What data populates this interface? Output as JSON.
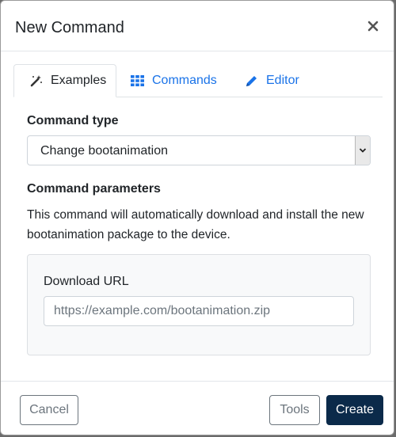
{
  "modal": {
    "title": "New Command",
    "close_icon": "close-icon"
  },
  "tabs": [
    {
      "label": "Examples",
      "icon": "magic-wand-icon",
      "active": true
    },
    {
      "label": "Commands",
      "icon": "grid-icon",
      "active": false
    },
    {
      "label": "Editor",
      "icon": "pencil-icon",
      "active": false
    }
  ],
  "command_type": {
    "label": "Command type",
    "selected": "Change bootanimation"
  },
  "command_parameters": {
    "label": "Command parameters",
    "description": "This command will automatically download and install the new bootanimation package to the device.",
    "fields": [
      {
        "label": "Download URL",
        "value": "",
        "placeholder": "https://example.com/bootanimation.zip"
      }
    ]
  },
  "footer": {
    "cancel_label": "Cancel",
    "tools_label": "Tools",
    "create_label": "Create"
  },
  "colors": {
    "link": "#1a73e8",
    "primary": "#0b2a4a",
    "secondary": "#6c757d"
  }
}
